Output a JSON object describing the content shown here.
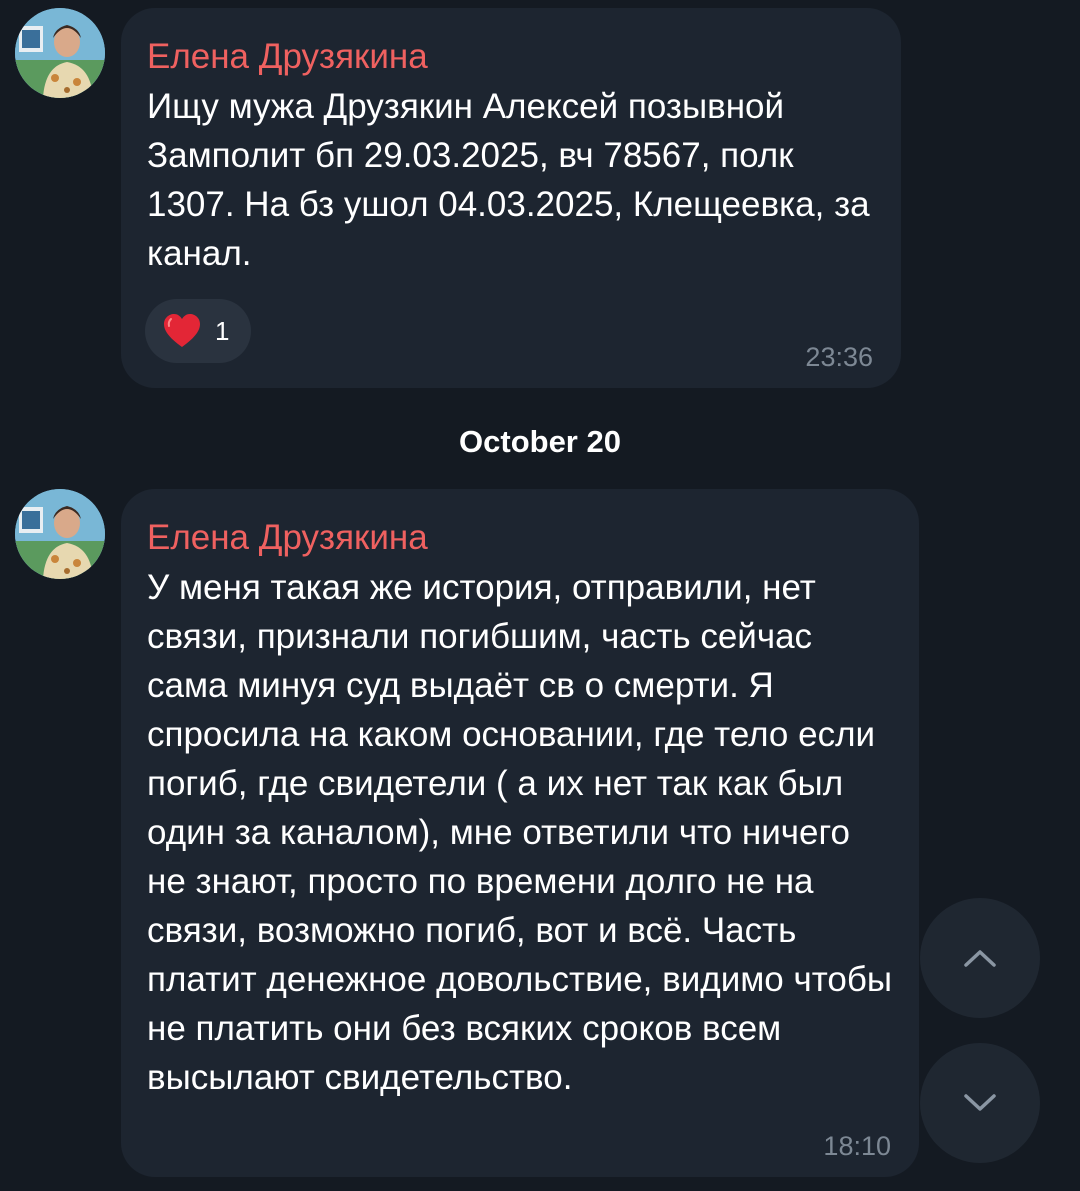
{
  "messages": [
    {
      "sender": "Елена Друзякина",
      "text": "Ищу мужа Друзякин Алексей позывной Замполит бп 29.03.2025, вч 78567, полк 1307. На бз ушол 04.03.2025, Клещеевка, за канал.",
      "time": "23:36",
      "reaction": {
        "emoji_icon": "heart-icon",
        "count": "1"
      }
    },
    {
      "sender": "Елена Друзякина",
      "text": "У меня такая же история, отправили, нет связи, признали погибшим, часть сейчас сама минуя суд выдаёт св о смерти. Я спросила на каком основании, где тело если погиб, где свидетели ( а их нет так как был один за каналом),  мне ответили что ничего не знают, просто по времени долго не на связи, возможно погиб, вот и всё. Часть платит денежное довольствие, видимо чтобы не платить они без всяких сроков всем высылают свидетельство.",
      "time": "18:10"
    }
  ],
  "date_separator": "October 20",
  "scroll_buttons": {
    "up_icon": "chevron-up-icon",
    "down_icon": "chevron-down-icon"
  },
  "colors": {
    "background": "#141a22",
    "bubble": "#1d2530",
    "sender_name": "#ef6160",
    "timestamp": "#7d8894",
    "reaction_pill": "#2a333f",
    "heart": "#e32636"
  }
}
